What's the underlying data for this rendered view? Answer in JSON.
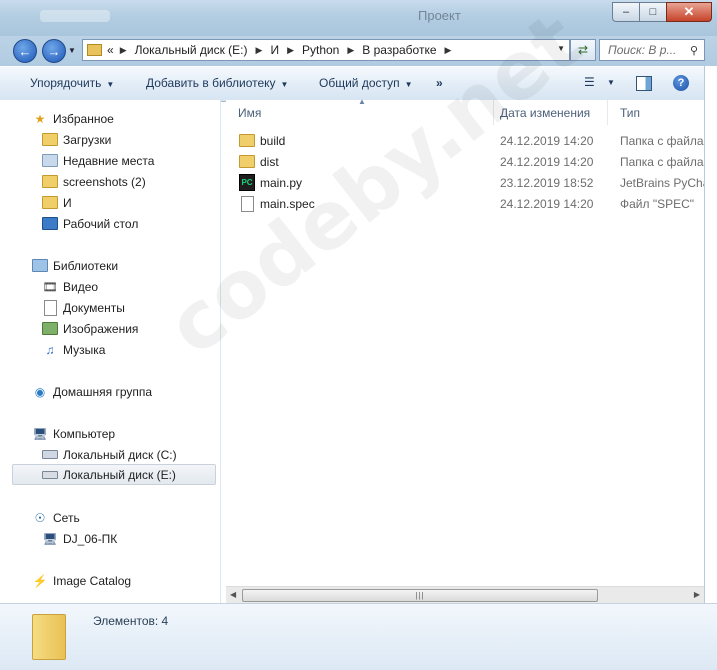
{
  "window": {
    "title": "Проект",
    "buttons": {
      "minimize": "–",
      "maximize": "□",
      "close": "✕"
    }
  },
  "address_bar": {
    "overflow": "«",
    "crumbs": [
      "Локальный диск (E:)",
      "И",
      "Python",
      "В разработке"
    ],
    "search_placeholder": "Поиск: В р..."
  },
  "toolbar": {
    "organize": "Упорядочить",
    "add_to_library": "Добавить в библиотеку",
    "share": "Общий доступ",
    "more": "»"
  },
  "nav": {
    "favorites": "Избранное",
    "downloads": "Загрузки",
    "recent": "Недавние места",
    "screenshots": "screenshots (2)",
    "folder_i": "И",
    "desktop": "Рабочий стол",
    "libraries": "Библиотеки",
    "video": "Видео",
    "documents": "Документы",
    "images": "Изображения",
    "music": "Музыка",
    "homegroup": "Домашняя группа",
    "computer": "Компьютер",
    "disk_c": "Локальный диск (C:)",
    "disk_e": "Локальный диск (E:)",
    "network": "Сеть",
    "pc_name": "DJ_06-ПК",
    "image_catalog": "Image Catalog"
  },
  "columns": {
    "name": "Имя",
    "date": "Дата изменения",
    "type": "Тип"
  },
  "files": [
    {
      "name": "build",
      "date": "24.12.2019 14:20",
      "type": "Папка с файлами",
      "icon": "folder-icon"
    },
    {
      "name": "dist",
      "date": "24.12.2019 14:20",
      "type": "Папка с файлами",
      "icon": "folder-icon"
    },
    {
      "name": "main.py",
      "date": "23.12.2019 18:52",
      "type": "JetBrains PyCharm",
      "icon": "pycharm-icon"
    },
    {
      "name": "main.spec",
      "date": "24.12.2019 14:20",
      "type": "Файл \"SPEC\"",
      "icon": "file-icon"
    }
  ],
  "details": {
    "item_count": "Элементов: 4"
  },
  "watermark": "codeby.net",
  "colors": {
    "accent": "#1e395b",
    "selection": "#e3e9ef",
    "folder": "#f0cf6a"
  }
}
